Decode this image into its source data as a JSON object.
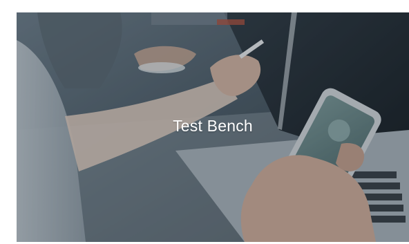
{
  "card": {
    "title": "Test Bench",
    "image_icon": "photo-hands-phone-laptop"
  },
  "colors": {
    "overlay": "#1e2630",
    "title_text": "#ffffff"
  }
}
